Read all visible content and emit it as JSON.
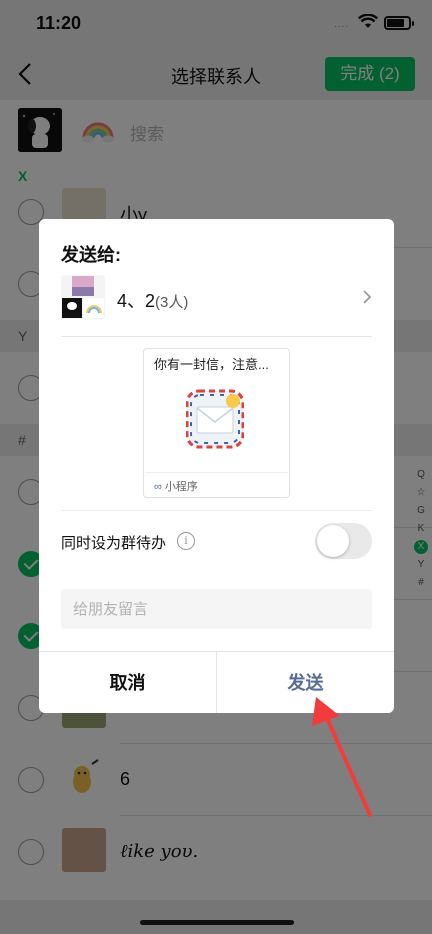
{
  "status_bar": {
    "time": "11:20",
    "signal": "...."
  },
  "nav": {
    "title": "选择联系人",
    "done_label": "完成 (2)"
  },
  "search": {
    "placeholder": "搜索"
  },
  "sections": {
    "x": "X",
    "y": "Y",
    "hash": "#"
  },
  "contacts": [
    {
      "name": "小y",
      "checked": false
    },
    {
      "name": "",
      "checked": false
    },
    {
      "name": "",
      "checked": false
    },
    {
      "name": "",
      "checked": false
    },
    {
      "name": "",
      "checked": true
    },
    {
      "name": "",
      "checked": true
    },
    {
      "name": "6",
      "checked": false
    },
    {
      "name": "6",
      "checked": false
    },
    {
      "name": "ℓike yoυ.",
      "checked": false
    }
  ],
  "index_bar": [
    "Q",
    "☆",
    "G",
    "K",
    "X",
    "Y",
    "#"
  ],
  "dialog": {
    "title": "发送给:",
    "group_name": "4、2",
    "group_count": "(3人)",
    "card_title": "你有一封信，注意...",
    "card_source": "小程序",
    "todo_label": "同时设为群待办",
    "todo_enabled": false,
    "message_placeholder": "给朋友留言",
    "cancel_label": "取消",
    "send_label": "发送"
  },
  "colors": {
    "accent_green": "#07c160",
    "link_blue": "#576b95",
    "arrow_red": "#f23c3c"
  },
  "icons": [
    "back-chevron-icon",
    "wifi-icon",
    "battery-icon",
    "chevron-right-icon",
    "info-icon",
    "envelope-icon",
    "mini-program-icon",
    "red-arrow-annotation"
  ]
}
